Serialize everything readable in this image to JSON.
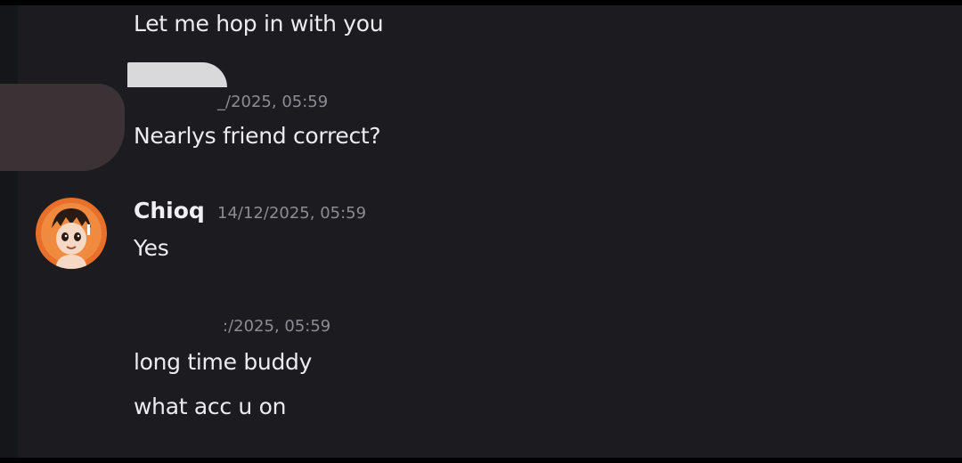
{
  "messages": [
    {
      "text": "Let me hop in with you"
    },
    {
      "timestamp": "_/2025, 05:59",
      "text": "Nearlys friend correct?"
    },
    {
      "username": "Chioq",
      "timestamp": "14/12/2025, 05:59",
      "text": "Yes"
    },
    {
      "timestamp": ":/2025, 05:59",
      "lines": [
        "long time buddy",
        "what acc u on"
      ]
    }
  ],
  "colors": {
    "background": "#1b1b20",
    "text": "#ececf0",
    "timestamp": "#8c8c94",
    "avatar_accent": "#e8702a",
    "redaction_light": "#d9d9dc",
    "redaction_dark": "#3b3235"
  },
  "icons": {
    "avatar": "cartoon-robot-boy-avatar-icon"
  }
}
